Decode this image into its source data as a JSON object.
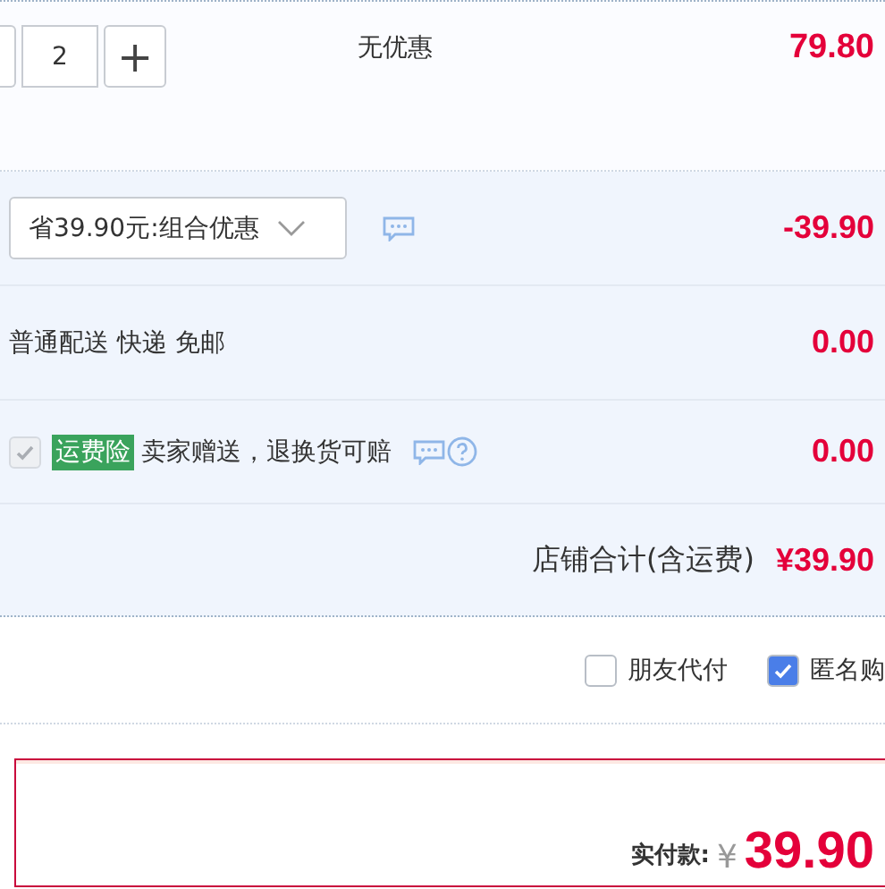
{
  "item": {
    "quantity": "2",
    "plus": "+",
    "promo": "无优惠",
    "price": "79.80"
  },
  "discount": {
    "selection": "省39.90元:组合优惠",
    "amount": "-39.90"
  },
  "shipping": {
    "text": "普通配送 快递 免邮",
    "amount": "0.00"
  },
  "insurance": {
    "checked": true,
    "disabled": true,
    "tag": "运费险",
    "text": "卖家赠送，退换货可赔",
    "amount": "0.00"
  },
  "store_total": {
    "label": "店铺合计(含运费)",
    "amount": "¥39.90"
  },
  "options": [
    {
      "label": "朋友代付",
      "checked": false
    },
    {
      "label": "匿名购",
      "checked": true
    }
  ],
  "payment": {
    "label": "实付款:",
    "currency": "¥",
    "amount": "39.90"
  }
}
